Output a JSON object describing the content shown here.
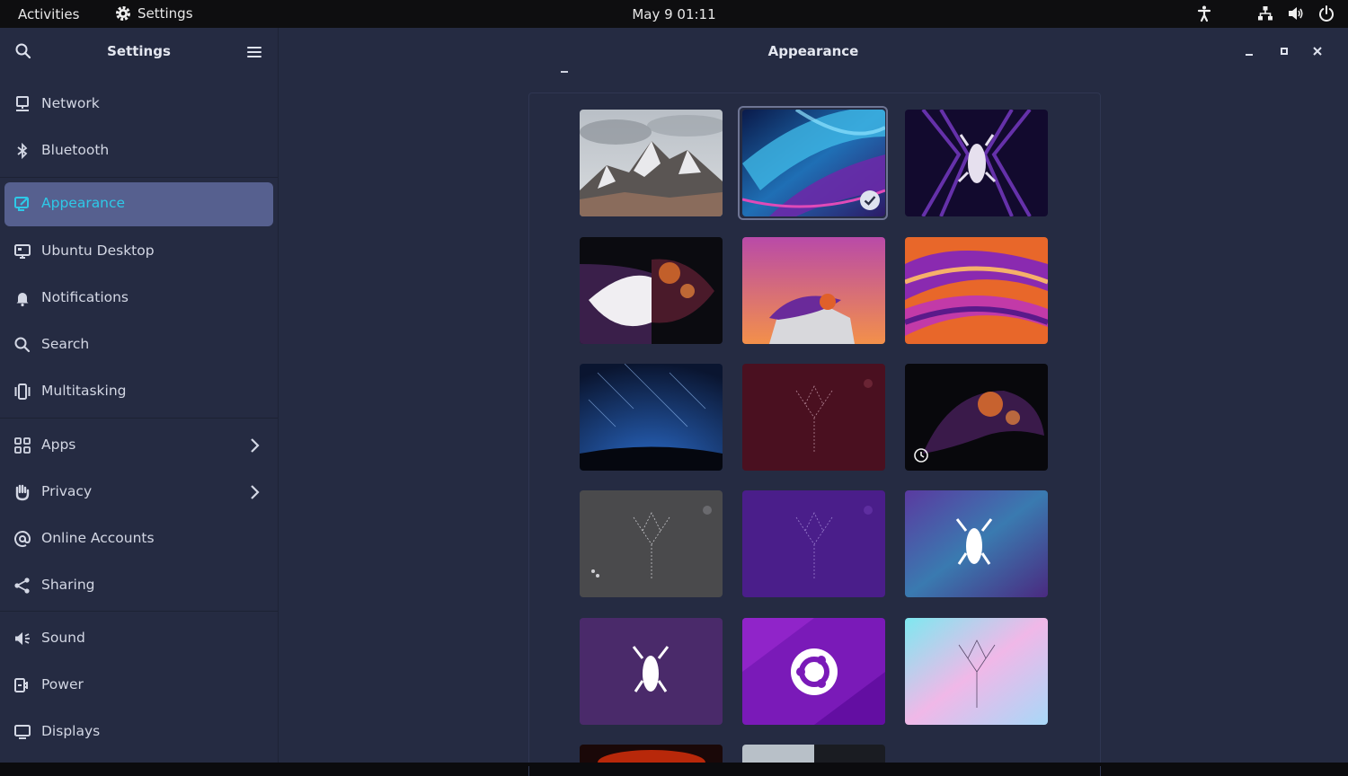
{
  "topbar": {
    "activities": "Activities",
    "app_name": "Settings",
    "clock": "May 9  01:11",
    "icons": [
      "accessibility-icon",
      "network-icon",
      "volume-icon",
      "power-icon"
    ]
  },
  "sidebar": {
    "title": "Settings",
    "items": [
      {
        "label": "Network",
        "icon": "network-icon"
      },
      {
        "label": "Bluetooth",
        "icon": "bluetooth-icon"
      },
      {
        "label": "Appearance",
        "icon": "appearance-icon",
        "active": true
      },
      {
        "label": "Ubuntu Desktop",
        "icon": "ubuntu-desktop-icon"
      },
      {
        "label": "Notifications",
        "icon": "bell-icon"
      },
      {
        "label": "Search",
        "icon": "search-icon"
      },
      {
        "label": "Multitasking",
        "icon": "multitasking-icon"
      },
      {
        "label": "Apps",
        "icon": "apps-grid-icon",
        "has_arrow": true
      },
      {
        "label": "Privacy",
        "icon": "hand-icon",
        "has_arrow": true
      },
      {
        "label": "Online Accounts",
        "icon": "at-icon"
      },
      {
        "label": "Sharing",
        "icon": "share-icon"
      },
      {
        "label": "Sound",
        "icon": "speaker-icon"
      },
      {
        "label": "Power",
        "icon": "power-plug-icon"
      },
      {
        "label": "Displays",
        "icon": "display-icon"
      }
    ]
  },
  "content": {
    "title": "Appearance",
    "selected_wallpaper": "Blue leaves",
    "wallpapers": [
      "Mountain peaks",
      "Blue leaves",
      "Purple lobster neon",
      "Split lobster",
      "Lobster on rock",
      "Orange purple swirl",
      "Star trails",
      "Maroon constellation",
      "Dark lobster",
      "Grey constellation",
      "Purple constellation",
      "Aurora lobster",
      "Purple lobster",
      "Ubuntu logo",
      "Pastel constellation"
    ]
  },
  "colors": {
    "accent": "#2ec9e8",
    "active_bg": "#56608f",
    "window_bg": "#252b42"
  }
}
